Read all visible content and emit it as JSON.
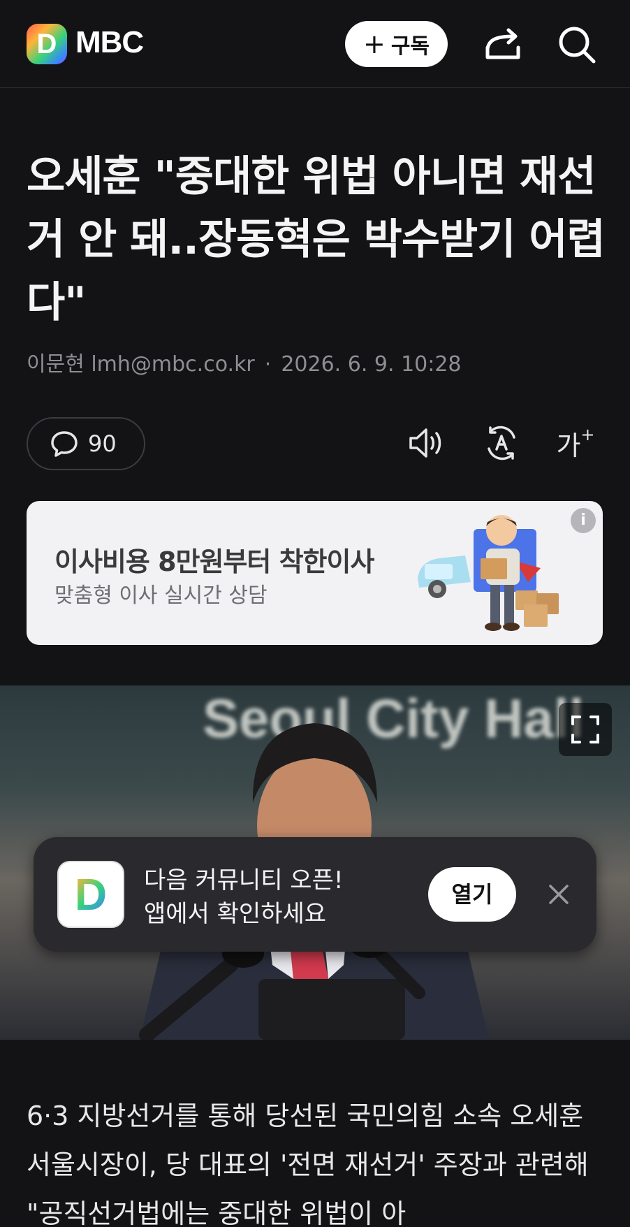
{
  "header": {
    "logo_letter": "D",
    "brand": "MBC",
    "subscribe_label": "구독",
    "subscribe_icon": "plus-icon",
    "share_icon": "share-icon",
    "search_icon": "search-icon"
  },
  "article": {
    "title": "오세훈 \"중대한 위법 아니면 재선거 안 돼..장동혁은 박수받기 어렵다\"",
    "author": "이문현 lmh@mbc.co.kr",
    "separator": "·",
    "date": "2026. 6. 9. 10:28",
    "comment_count": "90",
    "font_size_label": "가",
    "font_size_plus": "+",
    "body_first_lines": "6·3 지방선거를 통해 당선된 국민의힘 소속 오세훈 서울시장이, 당 대표의 '전면 재선거' 주장과 관련해 \"공직선거법에는 중대한 위법이 아"
  },
  "ad": {
    "title": "이사비용 8만원부터 착한이사",
    "subtitle": "맞춤형 이사 실시간 상담",
    "info_label": "i"
  },
  "photo": {
    "sign_text": "Seoul City Hall"
  },
  "toast": {
    "logo_letter": "D",
    "line1": "다음 커뮤니티 오픈!",
    "line2": "앱에서 확인하세요",
    "open_label": "열기"
  },
  "colors": {
    "background": "#131315",
    "ad_background": "#f2f2f4",
    "toast_background": "#2a2a2e"
  }
}
